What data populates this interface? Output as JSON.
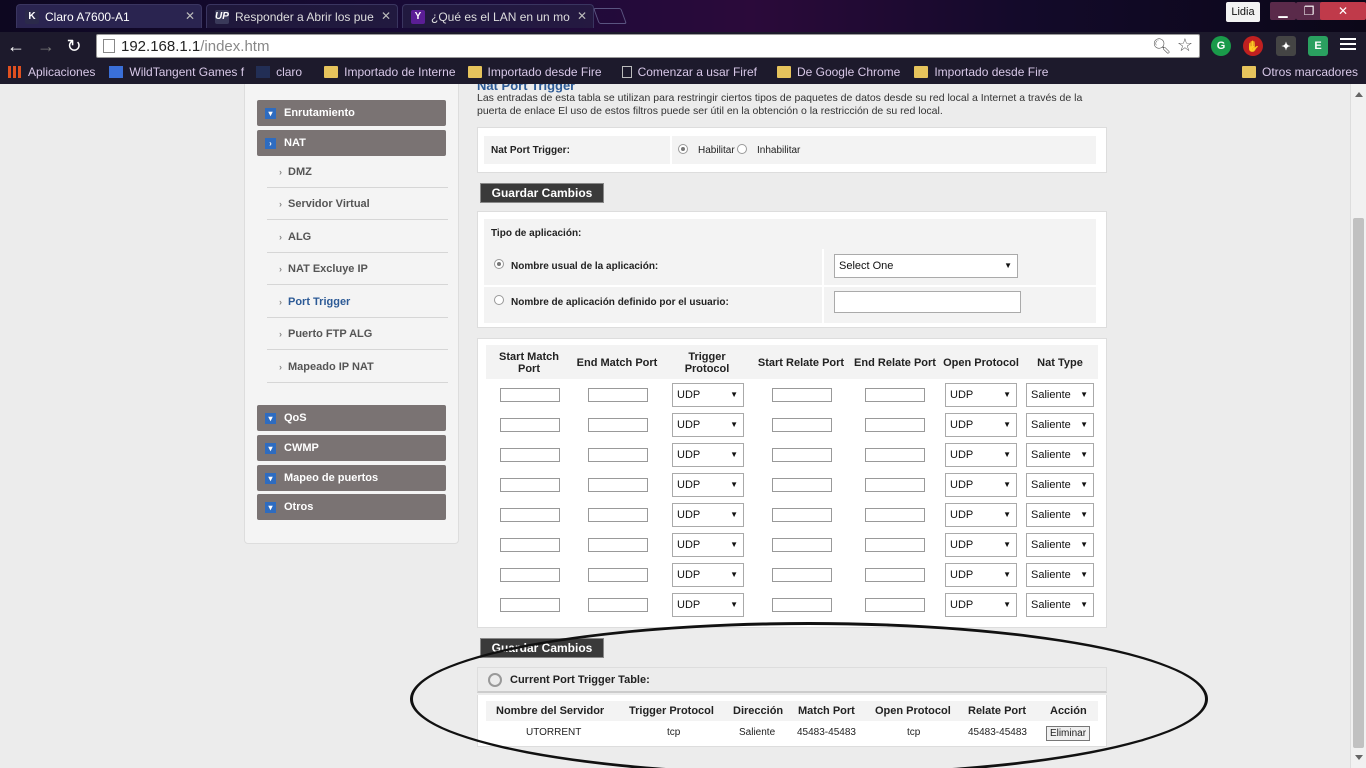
{
  "browser": {
    "tabs": [
      {
        "title": "Claro A7600-A1",
        "icon": "k-icon"
      },
      {
        "title": "Responder a Abrir los pue",
        "icon": "up-icon"
      },
      {
        "title": "¿Qué es el LAN en un mo",
        "icon": "yahoo-icon"
      }
    ],
    "user": "Lidia",
    "url_host": "192.168.1.1",
    "url_path": "/index.htm",
    "bookmarks": [
      "Aplicaciones",
      "WildTangent Games f",
      "claro",
      "Importado de Interne",
      "Importado desde Fire",
      "Comenzar a usar Firef",
      "De Google Chrome",
      "Importado desde Fire"
    ],
    "other_bookmarks": "Otros marcadores"
  },
  "sidebar": {
    "sections": [
      "Enrutamiento",
      "NAT",
      "QoS",
      "CWMP",
      "Mapeo de puertos",
      "Otros"
    ],
    "nat_items": [
      "DMZ",
      "Servidor Virtual",
      "ALG",
      "NAT Excluye IP",
      "Port Trigger",
      "Puerto FTP ALG",
      "Mapeado IP NAT"
    ]
  },
  "intro": {
    "title": "Nat Port Trigger",
    "text": "Las entradas de esta tabla se utilizan para restringir ciertos tipos de paquetes de datos desde su red local a Internet a través de la puerta de enlace El uso de estos filtros puede ser útil en la obtención o la restricción de su red local."
  },
  "trigger": {
    "label": "Nat Port Trigger:",
    "enable": "Habilitar",
    "disable": "Inhabilitar",
    "selected": "Habilitar"
  },
  "save_label": "Guardar Cambios",
  "app_type": {
    "heading": "Tipo de aplicación:",
    "common_label": "Nombre usual de la aplicación:",
    "common_value": "Select One",
    "user_label": "Nombre de aplicación definido por el usuario:",
    "user_value": ""
  },
  "rules": {
    "headers": [
      "Start Match Port",
      "End Match Port",
      "Trigger Protocol",
      "Start Relate Port",
      "End Relate Port",
      "Open Protocol",
      "Nat Type"
    ],
    "rows": [
      {
        "trigger": "UDP",
        "open": "UDP",
        "nat": "Saliente"
      },
      {
        "trigger": "UDP",
        "open": "UDP",
        "nat": "Saliente"
      },
      {
        "trigger": "UDP",
        "open": "UDP",
        "nat": "Saliente"
      },
      {
        "trigger": "UDP",
        "open": "UDP",
        "nat": "Saliente"
      },
      {
        "trigger": "UDP",
        "open": "UDP",
        "nat": "Saliente"
      },
      {
        "trigger": "UDP",
        "open": "UDP",
        "nat": "Saliente"
      },
      {
        "trigger": "UDP",
        "open": "UDP",
        "nat": "Saliente"
      },
      {
        "trigger": "UDP",
        "open": "UDP",
        "nat": "Saliente"
      }
    ]
  },
  "current_table": {
    "title": "Current Port Trigger Table:",
    "headers": [
      "Nombre del Servidor",
      "Trigger Protocol",
      "Dirección",
      "Match Port",
      "Open Protocol",
      "Relate Port",
      "Acción"
    ],
    "rows": [
      {
        "server": "UTORRENT",
        "trigger": "tcp",
        "direction": "Saliente",
        "match": "45483-45483",
        "open": "tcp",
        "relate": "45483-45483",
        "action": "Eliminar"
      }
    ]
  }
}
